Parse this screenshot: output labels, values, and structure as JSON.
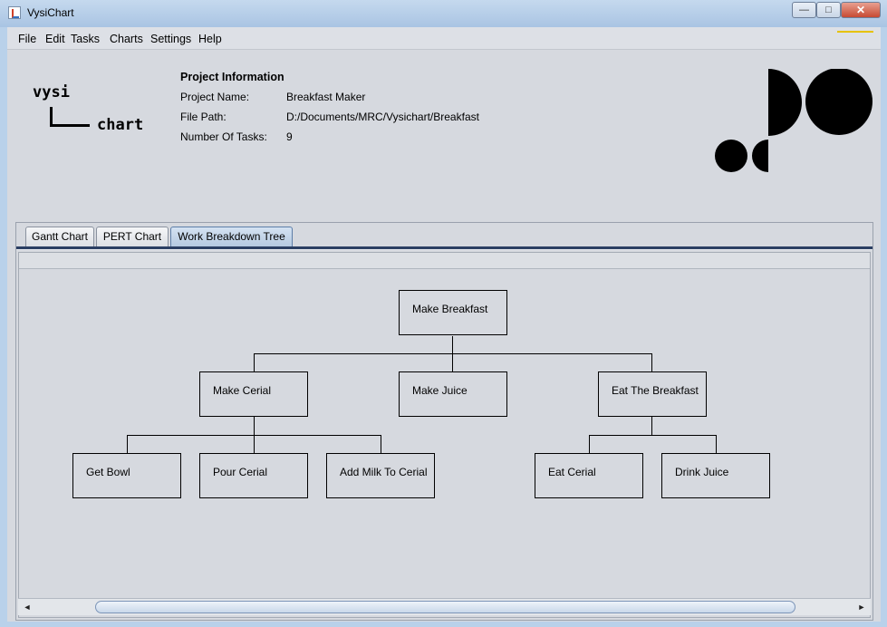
{
  "window": {
    "title": "VysiChart",
    "min_glyph": "—",
    "max_glyph": "□",
    "close_glyph": "✕"
  },
  "menu": [
    "File",
    "Edit",
    "Tasks",
    "Charts",
    "Settings",
    "Help"
  ],
  "logo": {
    "top": "vysi",
    "bottom": "chart"
  },
  "project_info": {
    "heading": "Project Information",
    "name_label": "Project Name:",
    "name_value": "Breakfast Maker",
    "path_label": "File Path:",
    "path_value": "D:/Documents/MRC/Vysichart/Breakfast",
    "tasks_label": "Number Of Tasks:",
    "tasks_value": "9"
  },
  "tabs": [
    "Gantt Chart",
    "PERT Chart",
    "Work Breakdown Tree"
  ],
  "active_tab": "Work Breakdown Tree",
  "tree": {
    "root": "Make Breakfast",
    "level1": [
      "Make Cerial",
      "Make Juice",
      "Eat The Breakfast"
    ],
    "level2": [
      "Get Bowl",
      "Pour Cerial",
      "Add Milk To Cerial",
      "Eat Cerial",
      "Drink Juice"
    ]
  },
  "scrollbar": {
    "left_arrow": "◄",
    "right_arrow": "►"
  },
  "colors": {
    "accent": "#2b3f63",
    "background": "#d6d9df",
    "window_frame": "#b9d1ea"
  }
}
